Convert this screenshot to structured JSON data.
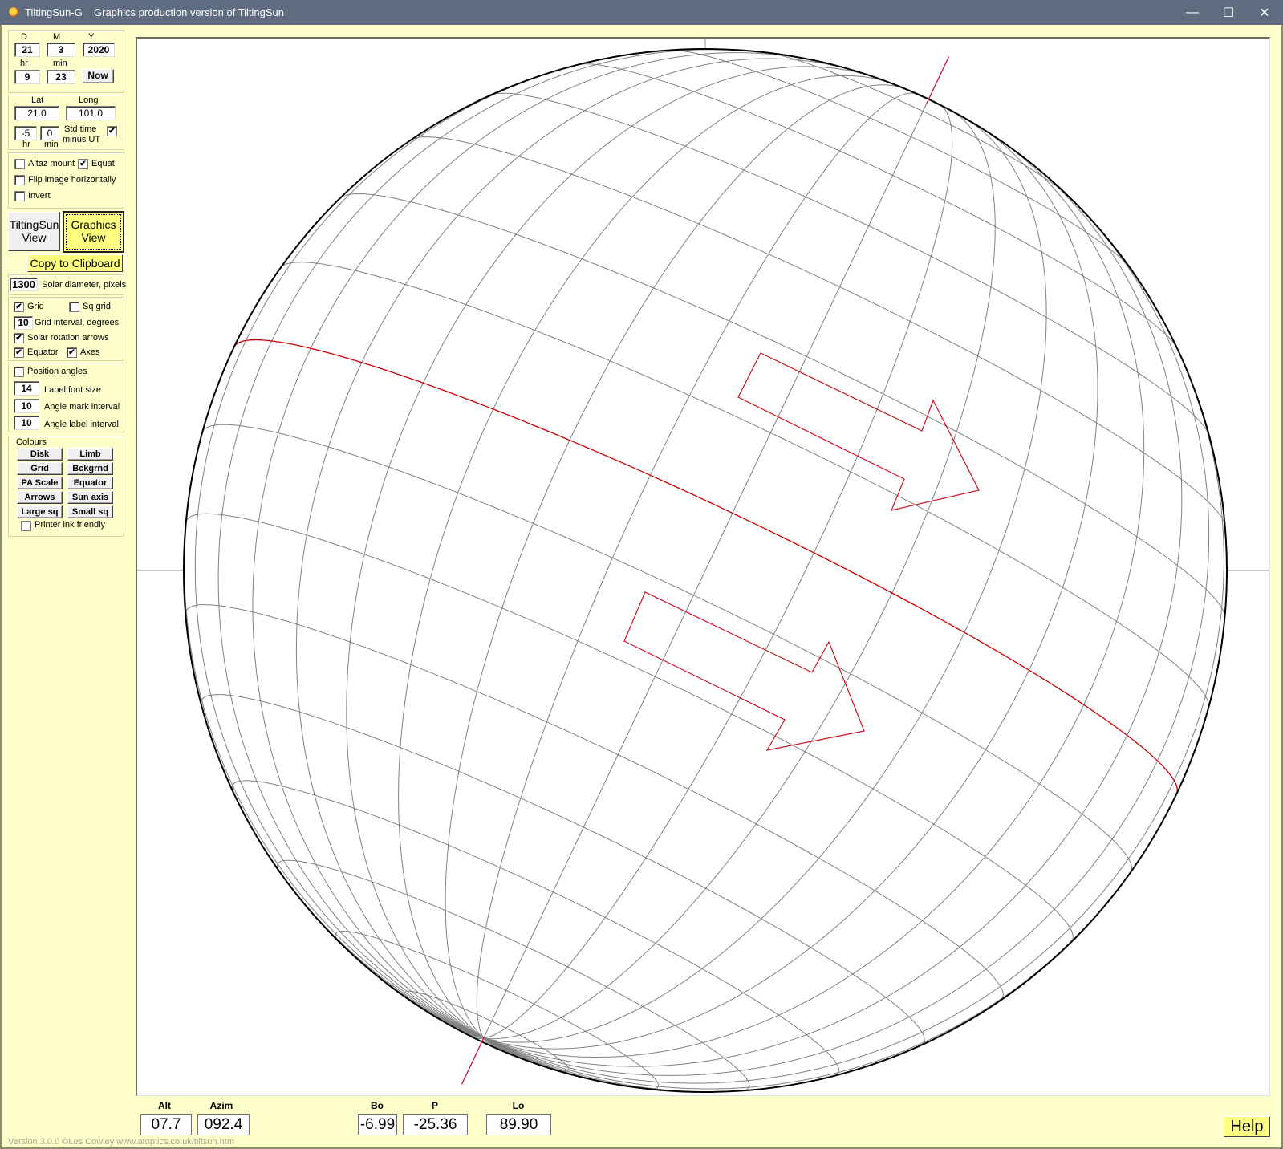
{
  "window": {
    "app_title": "TiltingSun-G",
    "subtitle": "Graphics production version of TiltingSun",
    "controls": {
      "minimize": "—",
      "maximize": "☐",
      "close": "✕"
    }
  },
  "datetime": {
    "day_label": "D",
    "month_label": "M",
    "year_label": "Y",
    "day": "21",
    "month": "3",
    "year": "2020",
    "hour_label": "hr",
    "min_label": "min",
    "hour": "9",
    "minute": "23",
    "now_button": "Now"
  },
  "location": {
    "lat_label": "Lat",
    "long_label": "Long",
    "lat": "21.0",
    "long": "101.0",
    "tz_hr": "-5",
    "tz_min": "0",
    "tz_hr_label": "hr",
    "tz_min_label": "min",
    "std_time_label_1": "Std time",
    "std_time_label_2": "minus UT",
    "std_time_checked": true
  },
  "mount": {
    "altaz_label": "Altaz mount",
    "altaz_checked": false,
    "equat_label": "Equat",
    "equat_checked": true,
    "flip_label": "Flip image horizontally",
    "flip_checked": false,
    "invert_label": "Invert",
    "invert_checked": false
  },
  "views": {
    "tiltingsun_view_1": "TiltingSun",
    "tiltingsun_view_2": "View",
    "graphics_view_1": "Graphics",
    "graphics_view_2": "View",
    "copy_clipboard": "Copy to Clipboard"
  },
  "solar": {
    "diameter": "1300",
    "diameter_label": "Solar diameter, pixels"
  },
  "grid": {
    "grid_label": "Grid",
    "grid_checked": true,
    "sqgrid_label": "Sq grid",
    "sqgrid_checked": false,
    "interval": "10",
    "interval_label": "Grid interval, degrees",
    "arrows_label": "Solar rotation arrows",
    "arrows_checked": true,
    "equator_label": "Equator",
    "equator_checked": true,
    "axes_label": "Axes",
    "axes_checked": true
  },
  "position_angles": {
    "label": "Position angles",
    "checked": false,
    "font_size": "14",
    "font_size_label": "Label font size",
    "mark_interval": "10",
    "mark_interval_label": "Angle mark interval",
    "label_interval": "10",
    "label_interval_label": "Angle label  interval"
  },
  "colours": {
    "title": "Colours",
    "buttons": [
      "Disk",
      "Limb",
      "Grid",
      "Bckgrnd",
      "PA Scale",
      "Equator",
      "Arrows",
      "Sun axis",
      "Large sq",
      "Small sq"
    ],
    "printer_label": "Printer ink friendly",
    "printer_checked": false
  },
  "readouts": {
    "alt_label": "Alt",
    "alt": "07.7",
    "azim_label": "Azim",
    "azim": "092.4",
    "bo_label": "Bo",
    "bo": "-6.99",
    "p_label": "P",
    "p": "-25.36",
    "lo_label": "Lo",
    "lo": "89.90"
  },
  "help_button": "Help",
  "version": "Version 3.0.0   ©Les Cowley www.atoptics.co.uk/tiltsun.htm",
  "graphic": {
    "P_deg": -25.36,
    "B0_deg": -6.99,
    "grid_interval_deg": 10,
    "colors": {
      "limb": "#000000",
      "grid": "#808080",
      "equator": "#cc0000",
      "arrows": "#cc1122",
      "axis": "#cc1133",
      "crosshair": "#909090"
    }
  }
}
